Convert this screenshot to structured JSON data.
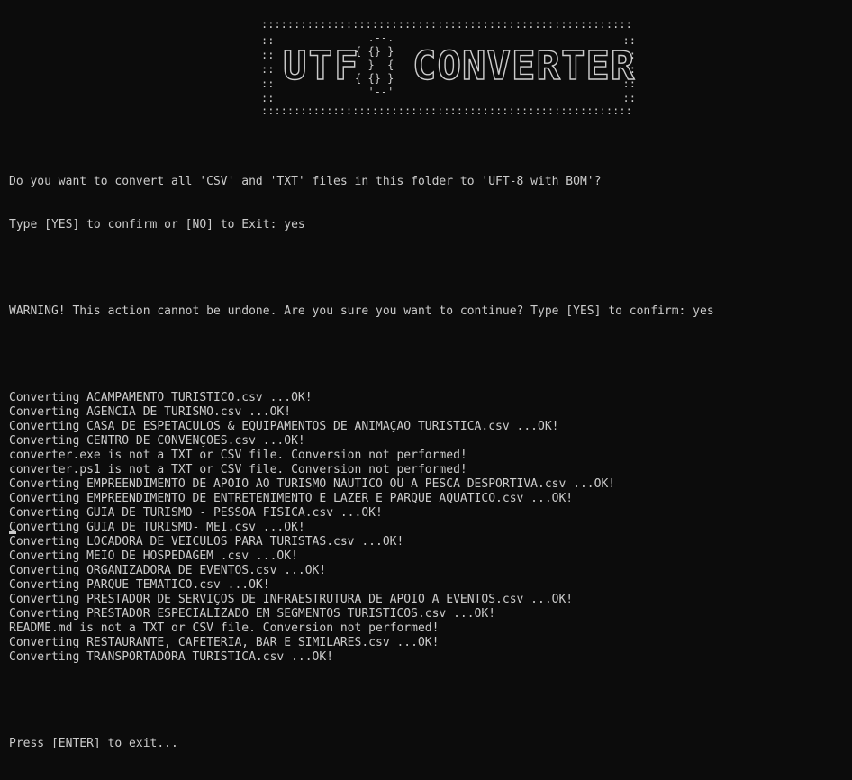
{
  "banner": {
    "border_top": ":::::::::::::::::::::::::::::::::::::::::::::::::::::::::",
    "border_bottom": ":::::::::::::::::::::::::::::::::::::::::::::::::::::::::",
    "side_left": "::\n::\n::\n::\n::",
    "side_right": "::\n::\n::\n::\n::",
    "logo": "  .--.\n{ {} }\n  }  {\n{ {} }\n  '--'",
    "word_left": "UTF",
    "word_right": "CONVERTER"
  },
  "console": {
    "prompt_line_1": "Do you want to convert all 'CSV' and 'TXT' files in this folder to 'UFT-8 with BOM'?",
    "prompt_line_2": "Type [YES] to confirm or [NO] to Exit: yes",
    "warning_line": "WARNING! This action cannot be undone. Are you sure you want to continue? Type [YES] to confirm: yes",
    "output_lines": [
      "Converting ACAMPAMENTO TURISTICO.csv ...OK!",
      "Converting AGENCIA DE TURISMO.csv ...OK!",
      "Converting CASA DE ESPETACULOS & EQUIPAMENTOS DE ANIMAÇAO TURISTICA.csv ...OK!",
      "Converting CENTRO DE CONVENÇOES.csv ...OK!",
      "converter.exe is not a TXT or CSV file. Conversion not performed!",
      "converter.ps1 is not a TXT or CSV file. Conversion not performed!",
      "Converting EMPREENDIMENTO DE APOIO AO TURISMO NAUTICO OU A PESCA DESPORTIVA.csv ...OK!",
      "Converting EMPREENDIMENTO DE ENTRETENIMENTO E LAZER E PARQUE AQUATICO.csv ...OK!",
      "Converting GUIA DE TURISMO - PESSOA FISICA.csv ...OK!",
      "Converting GUIA DE TURISMO- MEI.csv ...OK!",
      "Converting LOCADORA DE VEICULOS PARA TURISTAS.csv ...OK!",
      "Converting MEIO DE HOSPEDAGEM .csv ...OK!",
      "Converting ORGANIZADORA DE EVENTOS.csv ...OK!",
      "Converting PARQUE TEMATICO.csv ...OK!",
      "Converting PRESTADOR DE SERVIÇOS DE INFRAESTRUTURA DE APOIO A EVENTOS.csv ...OK!",
      "Converting PRESTADOR ESPECIALIZADO EM SEGMENTOS TURISTICOS.csv ...OK!",
      "README.md is not a TXT or CSV file. Conversion not performed!",
      "Converting RESTAURANTE, CAFETERIA, BAR E SIMILARES.csv ...OK!",
      "Converting TRANSPORTADORA TURISTICA.csv ...OK!"
    ],
    "exit_line": "Press [ENTER] to exit..."
  },
  "colors": {
    "background": "#0c0c0c",
    "foreground": "#cccccc"
  }
}
